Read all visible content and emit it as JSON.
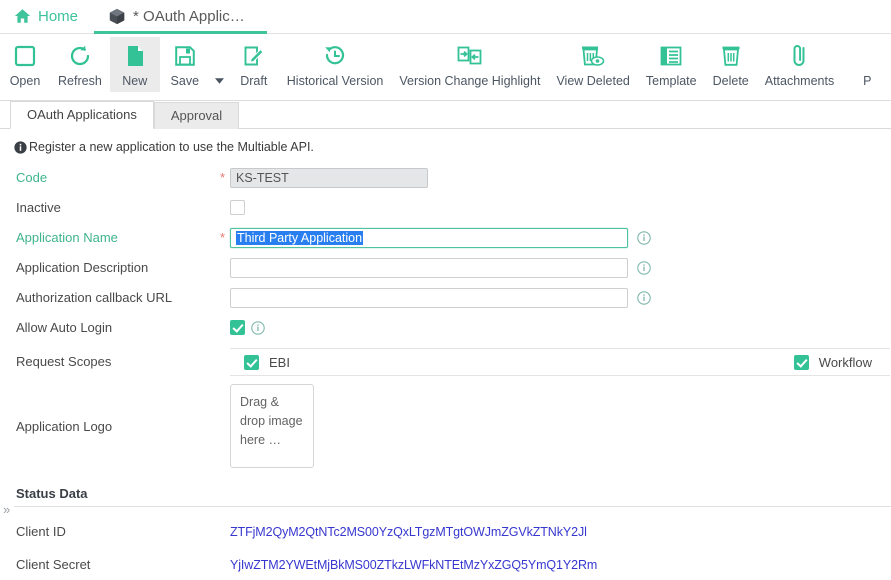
{
  "window_tabs": [
    {
      "label": "Home",
      "icon": "home-icon",
      "active": false
    },
    {
      "label": "* OAuth Applic…",
      "icon": "cube-icon",
      "active": true
    }
  ],
  "ribbon": {
    "items": [
      {
        "label": "Open",
        "icon": "open-square-icon",
        "active": false
      },
      {
        "label": "Refresh",
        "icon": "refresh-icon",
        "active": false
      },
      {
        "label": "New",
        "icon": "new-document-icon",
        "active": true
      },
      {
        "label": "Save",
        "icon": "save-floppy-icon",
        "active": false
      },
      {
        "label": "Draft",
        "icon": "draft-pencil-icon",
        "active": false
      },
      {
        "label": "Historical Version",
        "icon": "clock-history-icon",
        "active": false
      },
      {
        "label": "Version Change Highlight",
        "icon": "version-compare-icon",
        "active": false
      },
      {
        "label": "View Deleted",
        "icon": "trash-eye-icon",
        "active": false
      },
      {
        "label": "Template",
        "icon": "template-grid-icon",
        "active": false
      },
      {
        "label": "Delete",
        "icon": "trash-icon",
        "active": false
      },
      {
        "label": "Attachments",
        "icon": "paperclip-icon",
        "active": false
      },
      {
        "label": "P",
        "icon": "clipped-icon",
        "active": false
      }
    ],
    "save_dropdown_icon": "caret-down-icon"
  },
  "inner_tabs": [
    {
      "label": "OAuth Applications",
      "selected": true
    },
    {
      "label": "Approval",
      "selected": false
    }
  ],
  "form": {
    "note": "Register a new application to use the Multiable API.",
    "note_icon": "info-icon",
    "fields": {
      "code": {
        "label": "Code",
        "required": true,
        "value": "KS-TEST",
        "placeholder": ""
      },
      "inactive": {
        "label": "Inactive",
        "checked": false
      },
      "application_name": {
        "label": "Application Name",
        "required": true,
        "value": "Third Party Application",
        "placeholder": "",
        "selected_text": "Third Party Application"
      },
      "application_description": {
        "label": "Application Description",
        "required": false,
        "value": "",
        "placeholder": ""
      },
      "authorization_callback_url": {
        "label": "Authorization callback URL",
        "required": false,
        "value": "",
        "placeholder": ""
      },
      "allow_auto_login": {
        "label": "Allow Auto Login",
        "checked": true
      },
      "request_scopes": {
        "label": "Request Scopes",
        "options": [
          {
            "label": "EBI",
            "checked": true
          },
          {
            "label": "Workflow",
            "checked": true
          }
        ]
      },
      "application_logo": {
        "label": "Application Logo",
        "dropzone_text": "Drag & drop image here …"
      }
    }
  },
  "status_data": {
    "title": "Status Data",
    "expander_icon": "chevron-double-right-icon",
    "rows": [
      {
        "label": "Client ID",
        "value": "ZTFjM2QyM2QtNTc2MS00YzQxLTgzMTgtOWJmZGVkZTNkY2Jl"
      },
      {
        "label": "Client Secret",
        "value": "YjIwZTM2YWEtMjBkMS00ZTkzLWFkNTEtMzYxZGQ5YmQ1Y2Rm"
      }
    ]
  },
  "colors": {
    "accent": "#33c295",
    "link": "#3737d0",
    "required_star": "#e8776f",
    "selection": "#2a7ff0"
  }
}
